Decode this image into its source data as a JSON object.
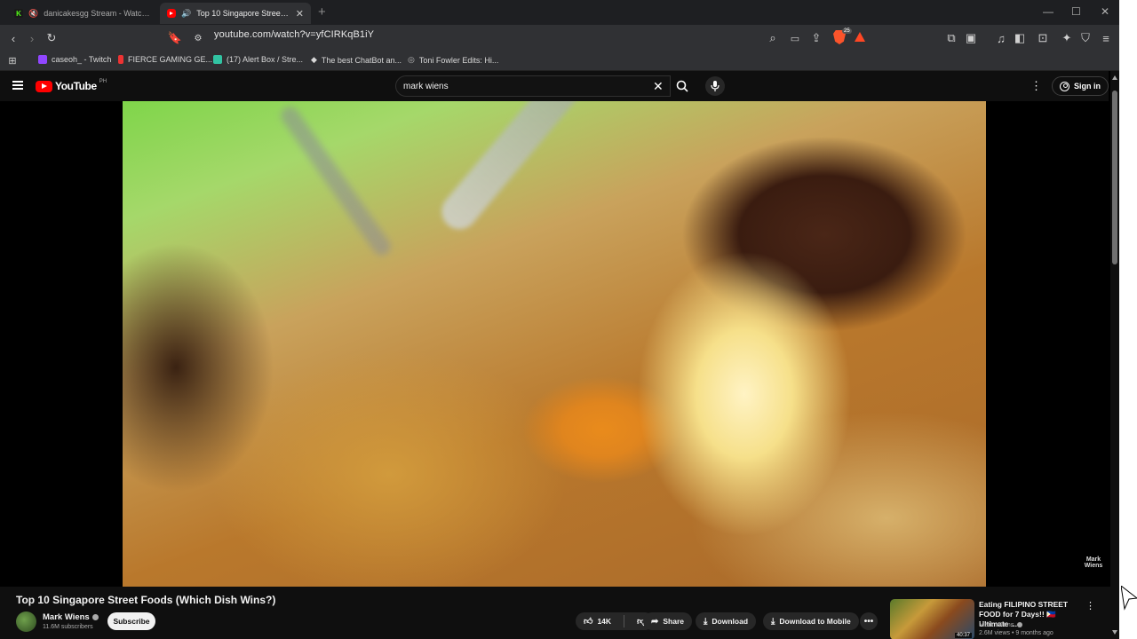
{
  "browser": {
    "tabs": [
      {
        "title": "danicakesgg Stream - Watch Live",
        "favicon": "kick-icon"
      },
      {
        "title": "Top 10 Singapore Street Foods",
        "favicon": "youtube-icon",
        "active": true
      }
    ],
    "url": "youtube.com/watch?v=yfCIRKqB1iY",
    "brave_badge": "25",
    "bookmarks": [
      {
        "label": "caseoh_ - Twitch",
        "icon": "twitch-icon",
        "color": "#9146ff"
      },
      {
        "label": "FIERCE GAMING GE...",
        "icon": "flame-icon",
        "color": "#e33"
      },
      {
        "label": "(17) Alert Box / Stre...",
        "icon": "streamlabs-icon",
        "color": "#31c3a2"
      },
      {
        "label": "The best ChatBot an...",
        "icon": "diamond-icon",
        "color": "#ffffff"
      },
      {
        "label": "Toni Fowler Edits: Hi...",
        "icon": "globe-icon",
        "color": "#bbbbbb"
      }
    ]
  },
  "youtube": {
    "logo_text": "YouTube",
    "country_code": "PH",
    "search_query": "mark wiens",
    "sign_in": "Sign in",
    "watermark": "Mark Wiens",
    "video": {
      "title": "Top 10 Singapore Street Foods (Which Dish Wins?)",
      "channel": "Mark Wiens",
      "subscribers": "11.6M subscribers",
      "subscribe_label": "Subscribe",
      "likes": "14K",
      "share_label": "Share",
      "download_label": "Download",
      "download_mobile_label": "Download to Mobile"
    },
    "recommended": {
      "title": "Eating FILIPINO STREET FOOD for 7 Days!! 🇵🇭 Ultimate ...",
      "channel": "Mark Wiens",
      "views": "2.6M views • 9 months ago",
      "duration": "40:37"
    }
  }
}
